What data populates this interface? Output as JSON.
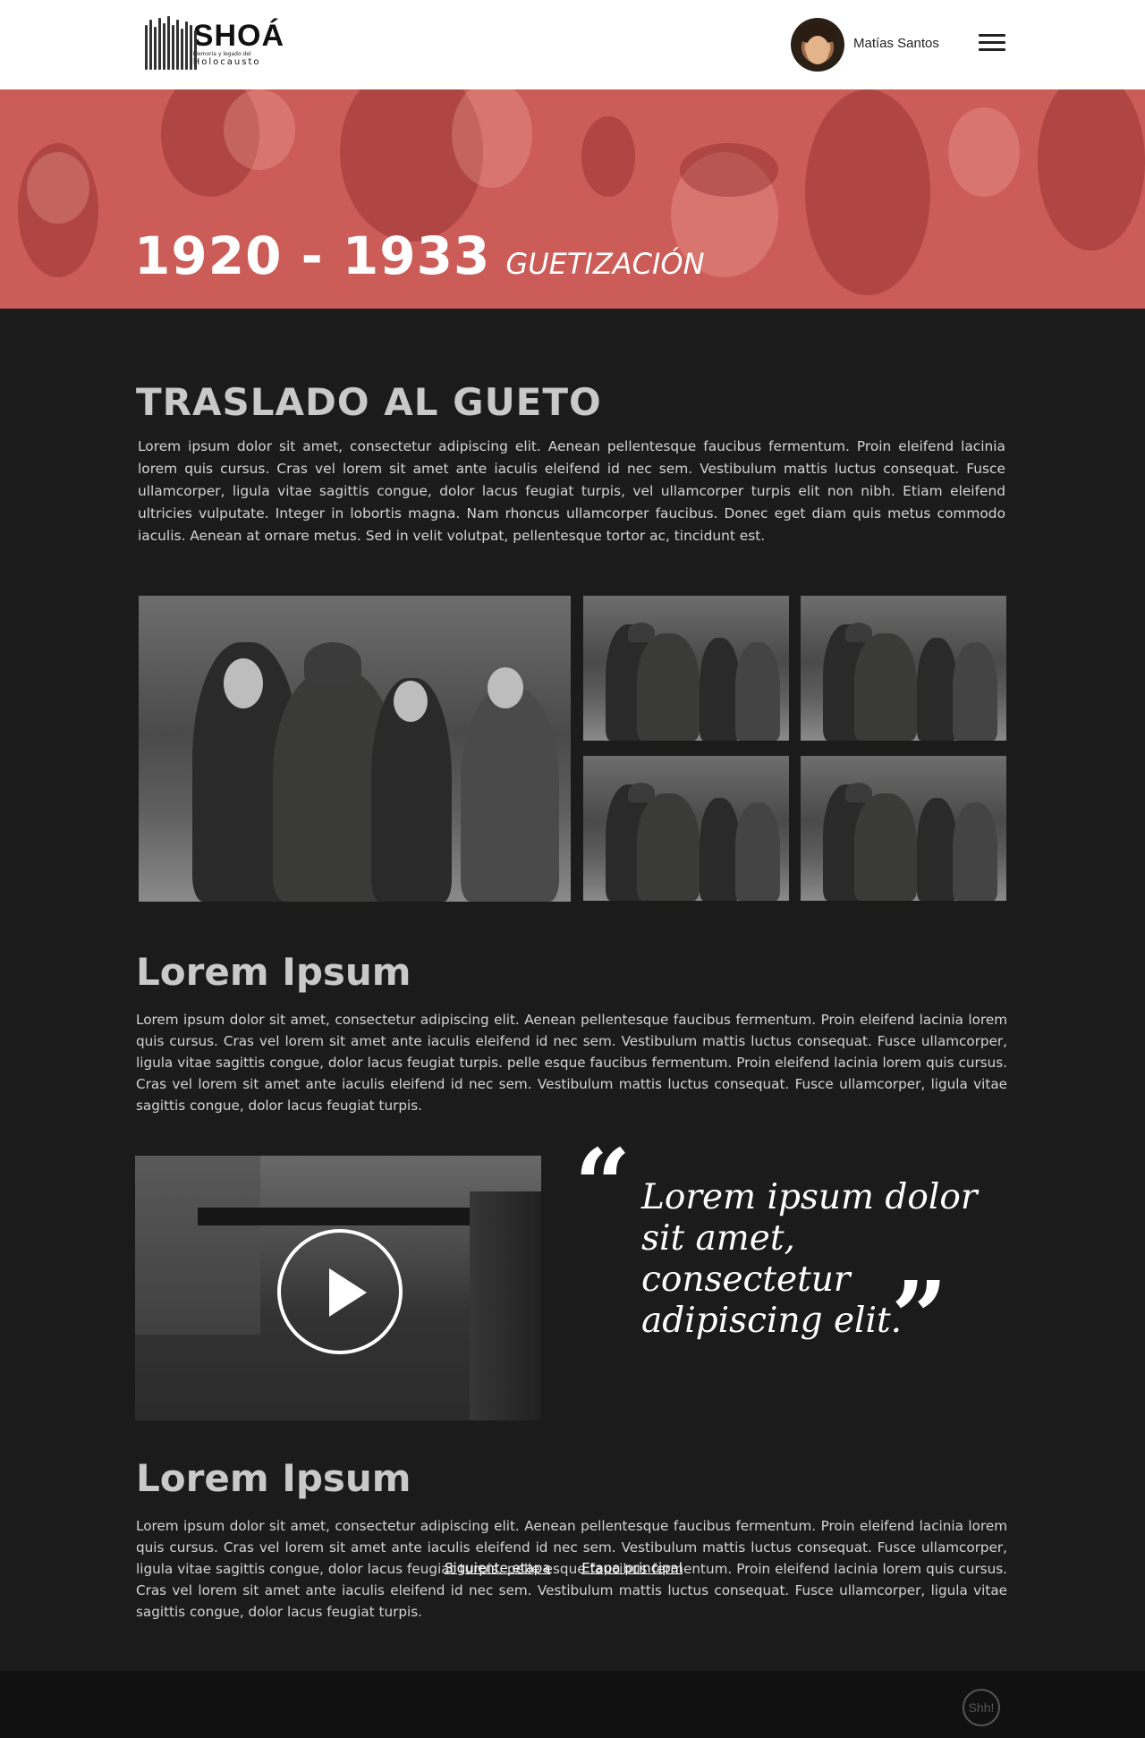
{
  "header": {
    "logo_title": "SHOÁ",
    "logo_tagline": "Memoria y legado del",
    "logo_tagline2": "Holocausto",
    "user_name": "Matías Santos",
    "menu_icon": "hamburger-icon"
  },
  "hero": {
    "years": "1920 - 1933",
    "stage": "GUETIZACIÓN",
    "overlay_color": "#cc5c58"
  },
  "section1": {
    "title": "TRASLADO AL GUETO",
    "body": "Lorem ipsum dolor sit amet, consectetur adipiscing elit. Aenean pellentesque faucibus fermentum. Proin eleifend lacinia lorem quis cursus. Cras vel lorem sit amet ante iaculis eleifend id nec sem. Vestibulum mattis luctus consequat. Fusce ullamcorper, ligula vitae sagittis congue, dolor lacus feugiat turpis, vel ullamcorper turpis elit non nibh. Etiam eleifend ultricies vulputate. Integer in lobortis magna. Nam rhoncus ullamcorper faucibus. Donec eget diam quis metus commodo iaculis. Aenean at ornare metus. Sed in velit volutpat, pellentesque tortor ac, tincidunt est."
  },
  "section2": {
    "title": "Lorem Ipsum",
    "body": "Lorem ipsum dolor sit amet, consectetur adipiscing elit. Aenean pellentesque faucibus fermentum. Proin eleifend lacinia lorem quis cursus. Cras vel lorem sit amet ante iaculis eleifend id nec sem. Vestibulum mattis luctus consequat. Fusce ullamcorper, ligula vitae sagittis congue, dolor lacus feugiat turpis. pelle esque faucibus fermentum. Proin eleifend lacinia lorem quis cursus. Cras vel lorem sit amet ante iaculis eleifend id nec sem. Vestibulum mattis luctus consequat. Fusce ullamcorper, ligula vitae sagittis congue, dolor lacus feugiat turpis."
  },
  "quote": {
    "open_mark": "“",
    "text": "Lorem ipsum dolor sit amet, consectetur adipiscing elit.",
    "close_mark": "”"
  },
  "section3": {
    "title": "Lorem Ipsum",
    "body": "Lorem ipsum dolor sit amet, consectetur adipiscing elit. Aenean pellentesque faucibus fermentum. Proin eleifend lacinia lorem quis cursus. Cras vel lorem sit amet ante iaculis eleifend id nec sem. Vestibulum mattis luctus consequat. Fusce ullamcorper, ligula vitae sagittis congue, dolor lacus feugiat turpis. pelle esque faucibus fermentum. Proin eleifend lacinia lorem quis cursus. Cras vel lorem sit amet ante iaculis eleifend id nec sem. Vestibulum mattis luctus consequat. Fusce ullamcorper, ligula vitae sagittis congue, dolor lacus feugiat turpis."
  },
  "nav": {
    "next_stage": "Siguiente etapa",
    "main_stage": "Etapa principal"
  },
  "footer": {
    "logo_text": "Shh!"
  }
}
